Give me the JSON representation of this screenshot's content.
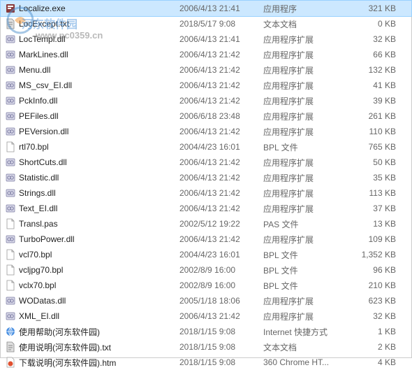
{
  "watermark": {
    "text": "河东软件园",
    "url": "www.pc0359.cn"
  },
  "files": [
    {
      "icon": "exe",
      "name": "Localize.exe",
      "date": "2006/4/13 21:41",
      "type": "应用程序",
      "size": "321 KB",
      "selected": true
    },
    {
      "icon": "txt",
      "name": "LocExcept.txt",
      "date": "2018/5/17 9:08",
      "type": "文本文档",
      "size": "0 KB"
    },
    {
      "icon": "dll",
      "name": "LocTempl.dll",
      "date": "2006/4/13 21:41",
      "type": "应用程序扩展",
      "size": "32 KB"
    },
    {
      "icon": "dll",
      "name": "MarkLines.dll",
      "date": "2006/4/13 21:42",
      "type": "应用程序扩展",
      "size": "66 KB"
    },
    {
      "icon": "dll",
      "name": "Menu.dll",
      "date": "2006/4/13 21:42",
      "type": "应用程序扩展",
      "size": "132 KB"
    },
    {
      "icon": "dll",
      "name": "MS_csv_EI.dll",
      "date": "2006/4/13 21:42",
      "type": "应用程序扩展",
      "size": "41 KB"
    },
    {
      "icon": "dll",
      "name": "PckInfo.dll",
      "date": "2006/4/13 21:42",
      "type": "应用程序扩展",
      "size": "39 KB"
    },
    {
      "icon": "dll",
      "name": "PEFiles.dll",
      "date": "2006/6/18 23:48",
      "type": "应用程序扩展",
      "size": "261 KB"
    },
    {
      "icon": "dll",
      "name": "PEVersion.dll",
      "date": "2006/4/13 21:42",
      "type": "应用程序扩展",
      "size": "110 KB"
    },
    {
      "icon": "bpl",
      "name": "rtl70.bpl",
      "date": "2004/4/23 16:01",
      "type": "BPL 文件",
      "size": "765 KB"
    },
    {
      "icon": "dll",
      "name": "ShortCuts.dll",
      "date": "2006/4/13 21:42",
      "type": "应用程序扩展",
      "size": "50 KB"
    },
    {
      "icon": "dll",
      "name": "Statistic.dll",
      "date": "2006/4/13 21:42",
      "type": "应用程序扩展",
      "size": "35 KB"
    },
    {
      "icon": "dll",
      "name": "Strings.dll",
      "date": "2006/4/13 21:42",
      "type": "应用程序扩展",
      "size": "113 KB"
    },
    {
      "icon": "dll",
      "name": "Text_EI.dll",
      "date": "2006/4/13 21:42",
      "type": "应用程序扩展",
      "size": "37 KB"
    },
    {
      "icon": "pas",
      "name": "Transl.pas",
      "date": "2002/5/12 19:22",
      "type": "PAS 文件",
      "size": "13 KB"
    },
    {
      "icon": "dll",
      "name": "TurboPower.dll",
      "date": "2006/4/13 21:42",
      "type": "应用程序扩展",
      "size": "109 KB"
    },
    {
      "icon": "bpl",
      "name": "vcl70.bpl",
      "date": "2004/4/23 16:01",
      "type": "BPL 文件",
      "size": "1,352 KB"
    },
    {
      "icon": "bpl",
      "name": "vcljpg70.bpl",
      "date": "2002/8/9 16:00",
      "type": "BPL 文件",
      "size": "96 KB"
    },
    {
      "icon": "bpl",
      "name": "vclx70.bpl",
      "date": "2002/8/9 16:00",
      "type": "BPL 文件",
      "size": "210 KB"
    },
    {
      "icon": "dll",
      "name": "WODatas.dll",
      "date": "2005/1/18 18:06",
      "type": "应用程序扩展",
      "size": "623 KB"
    },
    {
      "icon": "dll",
      "name": "XML_EI.dll",
      "date": "2006/4/13 21:42",
      "type": "应用程序扩展",
      "size": "32 KB"
    },
    {
      "icon": "url",
      "name": "使用帮助(河东软件园)",
      "date": "2018/1/15 9:08",
      "type": "Internet 快捷方式",
      "size": "1 KB"
    },
    {
      "icon": "txt",
      "name": "使用说明(河东软件园).txt",
      "date": "2018/1/15 9:08",
      "type": "文本文档",
      "size": "2 KB"
    },
    {
      "icon": "htm",
      "name": "下载说明(河东软件园).htm",
      "date": "2018/1/15 9:08",
      "type": "360 Chrome HT...",
      "size": "4 KB"
    }
  ]
}
